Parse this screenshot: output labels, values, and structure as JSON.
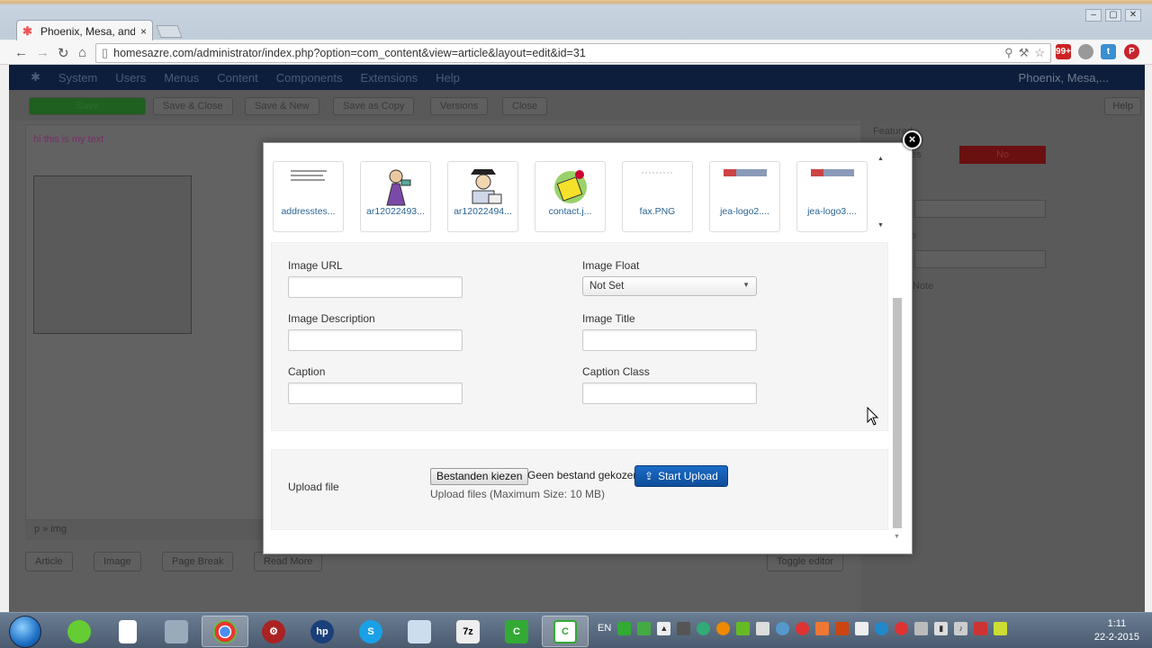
{
  "browser": {
    "tab_title": "Phoenix, Mesa, and T",
    "tab_close": "×",
    "url": "homesazre.com/administrator/index.php?option=com_content&view=article&layout=edit&id=31",
    "window_controls": [
      "–",
      "▢",
      "✕"
    ],
    "ext_badge": "99+"
  },
  "joomla": {
    "nav": [
      "System",
      "Users",
      "Menus",
      "Content",
      "Components",
      "Extensions",
      "Help"
    ],
    "user": "Phoenix, Mesa,...",
    "toolbar": [
      "Save",
      "Save & Close",
      "Save & New",
      "Save as Copy",
      "Versions",
      "Close"
    ],
    "help": "Help",
    "editor_text": "hi this is my text",
    "path": "p » img",
    "editor_buttons": [
      "Article",
      "Image",
      "Page Break",
      "Read More"
    ],
    "toggle_editor": "Toggle editor",
    "side": {
      "featured_label": "Featured",
      "yes_fragment": "es",
      "no_label": "No",
      "e_fragment": "e",
      "note_label": "Note"
    }
  },
  "modal": {
    "close_icon": "×",
    "thumbnails": [
      {
        "name": "addresstes...",
        "art": "text-lines"
      },
      {
        "name": "ar12022493...",
        "art": "cartoon-purple"
      },
      {
        "name": "ar12022494...",
        "art": "cartoon-man"
      },
      {
        "name": "contact.j...",
        "art": "yellow-phone"
      },
      {
        "name": "fax.PNG",
        "art": "faint-text"
      },
      {
        "name": "jea-logo2....",
        "art": "banner"
      },
      {
        "name": "jea-logo3....",
        "art": "banner"
      }
    ],
    "fields": {
      "image_url": {
        "label": "Image URL",
        "value": ""
      },
      "image_float": {
        "label": "Image Float",
        "selected": "Not Set"
      },
      "image_description": {
        "label": "Image Description",
        "value": ""
      },
      "image_title": {
        "label": "Image Title",
        "value": ""
      },
      "caption": {
        "label": "Caption",
        "value": ""
      },
      "caption_class": {
        "label": "Caption Class",
        "value": ""
      }
    },
    "upload": {
      "label": "Upload file",
      "choose_button": "Bestanden kiezen",
      "no_file": "Geen bestand gekozen",
      "start_button": "Start Upload",
      "hint": "Upload files (Maximum Size: 10 MB)"
    }
  },
  "taskbar": {
    "lang": "EN",
    "time": "1:11",
    "date": "22-2-2015",
    "apps": [
      "Logo Creator",
      "File",
      "Archive",
      "Chrome",
      "Settings",
      "HP",
      "Skype",
      "Window",
      "7z",
      "Camtasia",
      "Camtasia"
    ]
  }
}
